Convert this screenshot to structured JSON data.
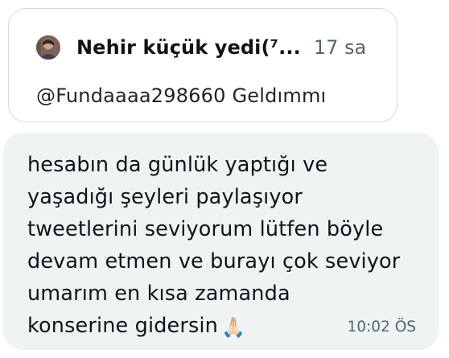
{
  "quoted_tweet": {
    "avatar_icon": "user-avatar",
    "author_name": "Nehir küçük yedi(⁷...",
    "time_ago": "17 sa",
    "mention": "@Fundaaaa298660",
    "text": "Geldımmı"
  },
  "message": {
    "text": "hesabın da günlük yaptığı ve\nyaşadığı şeyleri paylaşıyor\ntweetlerini seviyorum lütfen böyle\ndevam etmen ve burayı çok seviyor\numarım en kısa zamanda\nkonserine gidersin",
    "emoji": "🙏🏻",
    "emoji_icon": "folded-hands-icon",
    "time": "10:02 ÖS"
  },
  "colors": {
    "bubble_bg": "#eff3f4",
    "card_border": "#cfd9de",
    "secondary_text": "#536471",
    "primary_text": "#0f1419"
  }
}
